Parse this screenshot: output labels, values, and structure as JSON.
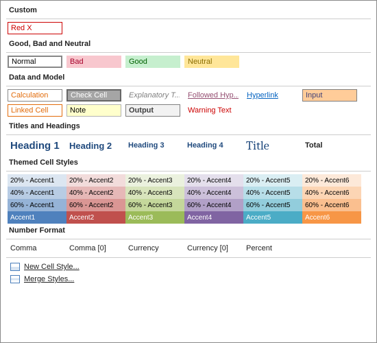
{
  "sections": {
    "custom": {
      "title": "Custom",
      "items": [
        "Red X"
      ]
    },
    "gbn": {
      "title": "Good, Bad and Neutral",
      "items": [
        "Normal",
        "Bad",
        "Good",
        "Neutral"
      ]
    },
    "data_model": {
      "title": "Data and Model",
      "row1": [
        "Calculation",
        "Check Cell",
        "Explanatory T...",
        "Followed Hyp...",
        "Hyperlink",
        "Input"
      ],
      "row2": [
        "Linked Cell",
        "Note",
        "Output",
        "Warning Text"
      ]
    },
    "titles": {
      "title": "Titles and Headings",
      "items": [
        "Heading 1",
        "Heading 2",
        "Heading 3",
        "Heading 4",
        "Title",
        "Total"
      ]
    },
    "themed": {
      "title": "Themed Cell Styles",
      "rows": [
        {
          "pct": "20%",
          "bg": [
            "#dce6f1",
            "#f2dcdb",
            "#ebf1de",
            "#e4dfec",
            "#daeef3",
            "#fde9d9"
          ],
          "fg": "#000"
        },
        {
          "pct": "40%",
          "bg": [
            "#b8cce4",
            "#e6b8b7",
            "#d8e4bc",
            "#ccc0da",
            "#b7dee8",
            "#fcd5b4"
          ],
          "fg": "#000"
        },
        {
          "pct": "60%",
          "bg": [
            "#95b3d7",
            "#da9694",
            "#c4d79b",
            "#b1a0c7",
            "#92cddc",
            "#fabf8f"
          ],
          "fg": "#000"
        },
        {
          "pct": "",
          "bg": [
            "#4f81bd",
            "#c0504d",
            "#9bbb59",
            "#8064a2",
            "#4bacc6",
            "#f79646"
          ],
          "fg": "#fff"
        }
      ],
      "names": [
        "Accent1",
        "Accent2",
        "Accent3",
        "Accent4",
        "Accent5",
        "Accent6"
      ]
    },
    "number_format": {
      "title": "Number Format",
      "items": [
        "Comma",
        "Comma [0]",
        "Currency",
        "Currency [0]",
        "Percent"
      ]
    },
    "footer": {
      "new_style": "New Cell Style...",
      "merge": "Merge Styles..."
    }
  }
}
